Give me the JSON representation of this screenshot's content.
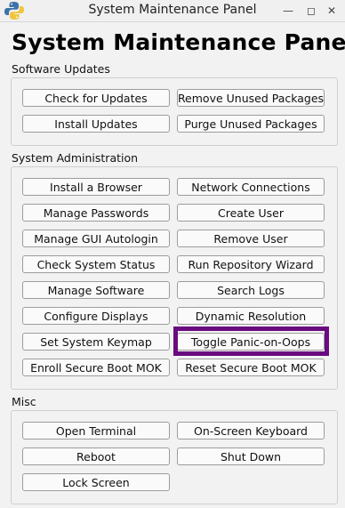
{
  "window": {
    "title": "System Maintenance Panel"
  },
  "heading": "System Maintenance Panel",
  "accent_color": "#6a0b7f",
  "sections": {
    "software_updates": {
      "label": "Software Updates",
      "buttons": [
        "Check for Updates",
        "Remove Unused Packages",
        "Install Updates",
        "Purge Unused Packages"
      ]
    },
    "system_administration": {
      "label": "System Administration",
      "buttons": [
        "Install a Browser",
        "Network Connections",
        "Manage Passwords",
        "Create User",
        "Manage GUI Autologin",
        "Remove User",
        "Check System Status",
        "Run Repository Wizard",
        "Manage Software",
        "Search Logs",
        "Configure Displays",
        "Dynamic Resolution",
        "Set System Keymap",
        "Toggle Panic-on-Oops",
        "Enroll Secure Boot MOK",
        "Reset Secure Boot MOK"
      ],
      "focused_button": "Toggle Panic-on-Oops"
    },
    "misc": {
      "label": "Misc",
      "buttons": [
        "Open Terminal",
        "On-Screen Keyboard",
        "Reboot",
        "Shut Down",
        "Lock Screen"
      ]
    }
  }
}
